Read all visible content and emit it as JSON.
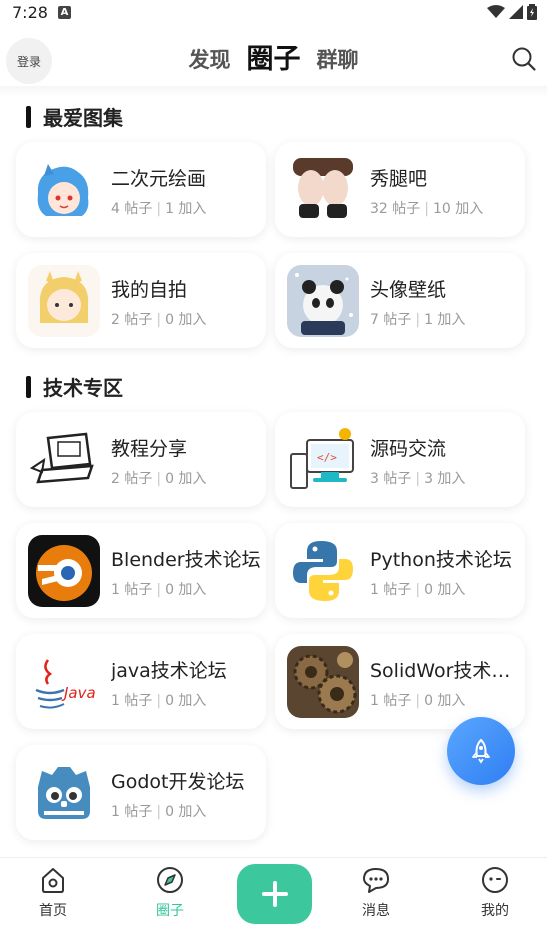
{
  "status_bar": {
    "time": "7:28",
    "badge": "A"
  },
  "header": {
    "login_label": "登录",
    "tabs": [
      {
        "label": "发现"
      },
      {
        "label": "圈子"
      },
      {
        "label": "群聊"
      }
    ]
  },
  "sections": [
    {
      "title": "最爱图集"
    },
    {
      "title": "技术专区"
    }
  ],
  "cards": [
    {
      "name": "二次元绘画",
      "posts": "4 帖子",
      "joins": "1 加入"
    },
    {
      "name": "秀腿吧",
      "posts": "32 帖子",
      "joins": "10 加入"
    },
    {
      "name": "我的自拍",
      "posts": "2 帖子",
      "joins": "0 加入"
    },
    {
      "name": "头像壁纸",
      "posts": "7 帖子",
      "joins": "1 加入"
    },
    {
      "name": "教程分享",
      "posts": "2 帖子",
      "joins": "0 加入"
    },
    {
      "name": "源码交流",
      "posts": "3 帖子",
      "joins": "3 加入"
    },
    {
      "name": "Blender技术论坛",
      "posts": "1 帖子",
      "joins": "0 加入"
    },
    {
      "name": "Python技术论坛",
      "posts": "1 帖子",
      "joins": "0 加入"
    },
    {
      "name": "java技术论坛",
      "posts": "1 帖子",
      "joins": "0 加入"
    },
    {
      "name": "SolidWor技术论坛",
      "posts": "1 帖子",
      "joins": "0 加入"
    },
    {
      "name": "Godot开发论坛",
      "posts": "1 帖子",
      "joins": "0 加入"
    }
  ],
  "thumb_text": {
    "java": "Java"
  },
  "bottom_nav": [
    {
      "label": "首页"
    },
    {
      "label": "圈子"
    },
    {
      "label": "消息"
    },
    {
      "label": "我的"
    }
  ],
  "colors": {
    "accent_green": "#3cc79d",
    "fab_blue": "#2f7ef2"
  },
  "icons": [
    "search-icon",
    "rocket-icon",
    "home-icon",
    "compass-icon",
    "plus-icon",
    "chat-icon",
    "profile-icon"
  ]
}
